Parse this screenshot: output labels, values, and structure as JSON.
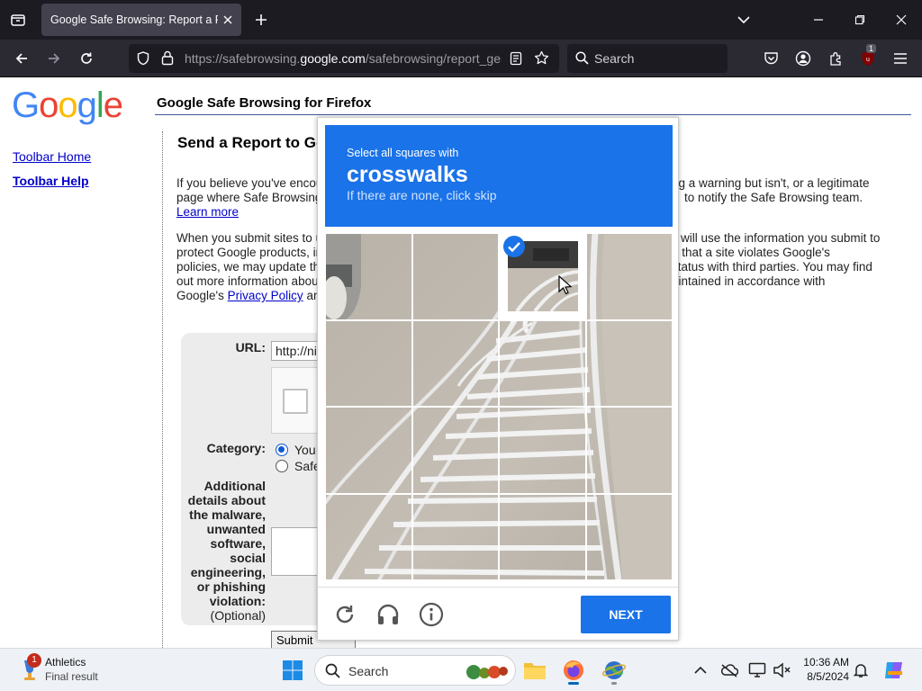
{
  "browser": {
    "tab_title": "Google Safe Browsing: Report a Phishing Page",
    "url_prefix": "https://safebrowsing.",
    "url_domain": "google.com",
    "url_path": "/safebrowsing/report_general/",
    "search_placeholder": "Search",
    "extension_badge": "1"
  },
  "page": {
    "logo": [
      "G",
      "o",
      "o",
      "g",
      "l",
      "e"
    ],
    "logo_colors": [
      "#4285f4",
      "#ea4335",
      "#fbbc05",
      "#4285f4",
      "#34a853",
      "#ea4335"
    ],
    "header_title": "Google Safe Browsing for Firefox",
    "sidebar": [
      {
        "label": "Toolbar Home"
      },
      {
        "label": "Toolbar Help"
      }
    ],
    "heading": "Send a Report to Go",
    "para1_a": "If you believe you've encour",
    "para1_b": "page where Safe Browsing",
    "para1_link": "Learn more",
    "para1_right_a": "ng a warning but isn't, or a legitimate",
    "para1_right_b": "to notify the Safe Browsing team.",
    "para2_lines": [
      "When you submit sites to u",
      "protect Google products, in",
      "policies, we may update th",
      "out more information about"
    ],
    "para2_last_prefix": "Google's",
    "para2_link": "Privacy Policy",
    "para2_last_suffix": "an",
    "para2_right_lines": [
      "will use the information you submit to",
      "e that a site violates Google's",
      "status with third parties. You may find",
      "aintained in accordance with"
    ],
    "form": {
      "url_label": "URL:",
      "url_value": "http://ni",
      "category_label": "Category:",
      "category_options": [
        "You",
        "Safe"
      ],
      "details_label": [
        "Additional",
        "details about",
        "the malware,",
        "unwanted",
        "software,",
        "social",
        "engineering,",
        "or phishing",
        "violation:"
      ],
      "optional": "(Optional)",
      "submit": "Submit Report"
    }
  },
  "captcha": {
    "instruction": "Select all squares with",
    "target": "crosswalks",
    "subtext": "If there are none, click skip",
    "selected_tiles": [
      2
    ],
    "next_label": "NEXT",
    "accent": "#1a73e8"
  },
  "taskbar": {
    "weather_title": "Athletics",
    "weather_subtitle": "Final result",
    "weather_badge": "1",
    "search_placeholder": "Search",
    "time": "10:36 AM",
    "date": "8/5/2024"
  }
}
